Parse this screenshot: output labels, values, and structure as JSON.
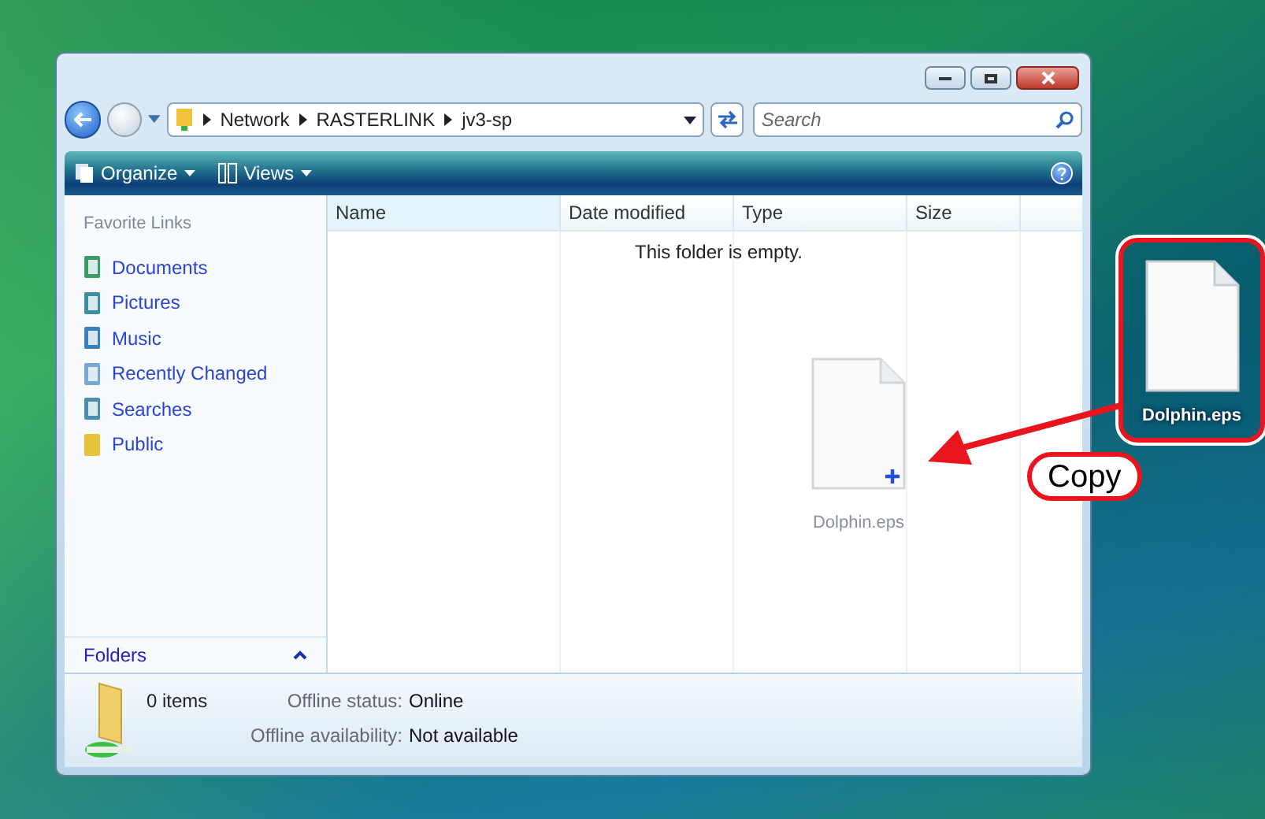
{
  "address_bar": {
    "path": [
      "Network",
      "RASTERLINK",
      "jv3-sp"
    ]
  },
  "search": {
    "placeholder": "Search"
  },
  "toolbar": {
    "buttons": [
      "Organize",
      "Views"
    ]
  },
  "sidebar": {
    "title": "Favorite Links",
    "items": [
      {
        "label": "Documents",
        "kind": "documents"
      },
      {
        "label": "Pictures",
        "kind": "pictures"
      },
      {
        "label": "Music",
        "kind": "music"
      },
      {
        "label": "Recently Changed",
        "kind": "recent"
      },
      {
        "label": "Searches",
        "kind": "searches"
      },
      {
        "label": "Public",
        "kind": "folder"
      }
    ],
    "folders_label": "Folders"
  },
  "file_list": {
    "columns": [
      "Name",
      "Date modified",
      "Type",
      "Size"
    ],
    "empty_message": "This folder is empty.",
    "drag_ghost_label": "Dolphin.eps"
  },
  "details_pane": {
    "count": "0 items",
    "fields": [
      {
        "label": "Offline status:",
        "value": "Online"
      },
      {
        "label": "Offline availability:",
        "value": "Not available"
      }
    ]
  },
  "desktop_icon": {
    "label": "Dolphin.eps"
  },
  "annotation": {
    "label": "Copy"
  }
}
